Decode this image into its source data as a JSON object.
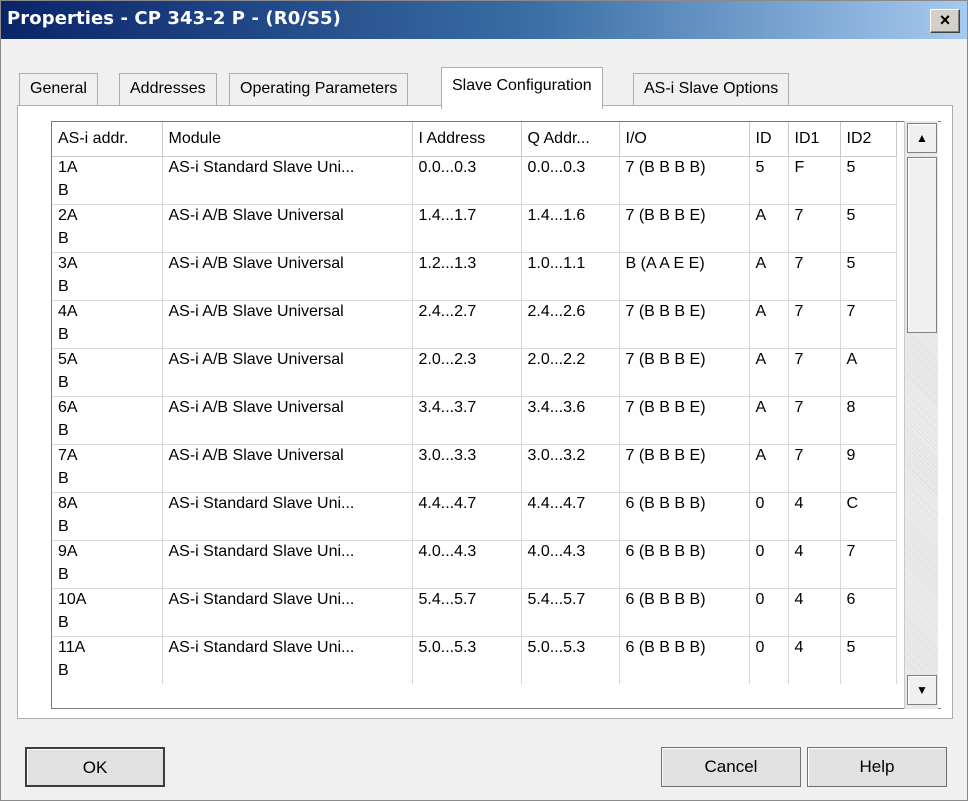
{
  "window": {
    "title": "Properties - CP 343-2 P - (R0/S5)",
    "close_glyph": "×"
  },
  "tabs": [
    {
      "label": "General"
    },
    {
      "label": "Addresses"
    },
    {
      "label": "Operating Parameters"
    },
    {
      "label": "Slave Configuration",
      "active": true
    },
    {
      "label": "AS-i Slave Options"
    }
  ],
  "table": {
    "columns": [
      "AS-i addr.",
      "Module",
      "I Address",
      "Q Addr...",
      "I/O",
      "ID",
      "ID1",
      "ID2"
    ],
    "rows": [
      [
        "1A",
        "AS-i Standard Slave Uni...",
        "0.0...0.3",
        "0.0...0.3",
        "7  (B B B B)",
        "5",
        "F",
        "5"
      ],
      [
        "B",
        "",
        "",
        "",
        "",
        "",
        "",
        ""
      ],
      [
        "2A",
        "AS-i A/B Slave Universal",
        "1.4...1.7",
        "1.4...1.6",
        "7  (B B B E)",
        "A",
        "7",
        "5"
      ],
      [
        "B",
        "",
        "",
        "",
        "",
        "",
        "",
        ""
      ],
      [
        "3A",
        "AS-i A/B Slave Universal",
        "1.2...1.3",
        "1.0...1.1",
        "B  (A A E E)",
        "A",
        "7",
        "5"
      ],
      [
        "B",
        "",
        "",
        "",
        "",
        "",
        "",
        ""
      ],
      [
        "4A",
        "AS-i A/B Slave Universal",
        "2.4...2.7",
        "2.4...2.6",
        "7  (B B B E)",
        "A",
        "7",
        "7"
      ],
      [
        "B",
        "",
        "",
        "",
        "",
        "",
        "",
        ""
      ],
      [
        "5A",
        "AS-i A/B Slave Universal",
        "2.0...2.3",
        "2.0...2.2",
        "7  (B B B E)",
        "A",
        "7",
        "A"
      ],
      [
        "B",
        "",
        "",
        "",
        "",
        "",
        "",
        ""
      ],
      [
        "6A",
        "AS-i A/B Slave Universal",
        "3.4...3.7",
        "3.4...3.6",
        "7  (B B B E)",
        "A",
        "7",
        "8"
      ],
      [
        "B",
        "",
        "",
        "",
        "",
        "",
        "",
        ""
      ],
      [
        "7A",
        "AS-i A/B Slave Universal",
        "3.0...3.3",
        "3.0...3.2",
        "7  (B B B E)",
        "A",
        "7",
        "9"
      ],
      [
        "B",
        "",
        "",
        "",
        "",
        "",
        "",
        ""
      ],
      [
        "8A",
        "AS-i Standard Slave Uni...",
        "4.4...4.7",
        "4.4...4.7",
        "6  (B B B B)",
        "0",
        "4",
        "C"
      ],
      [
        "B",
        "",
        "",
        "",
        "",
        "",
        "",
        ""
      ],
      [
        "9A",
        "AS-i Standard Slave Uni...",
        "4.0...4.3",
        "4.0...4.3",
        "6  (B B B B)",
        "0",
        "4",
        "7"
      ],
      [
        "B",
        "",
        "",
        "",
        "",
        "",
        "",
        ""
      ],
      [
        "10A",
        "AS-i Standard Slave Uni...",
        "5.4...5.7",
        "5.4...5.7",
        "6  (B B B B)",
        "0",
        "4",
        "6"
      ],
      [
        "B",
        "",
        "",
        "",
        "",
        "",
        "",
        ""
      ],
      [
        "11A",
        "AS-i Standard Slave Uni...",
        "5.0...5.3",
        "5.0...5.3",
        "6  (B B B B)",
        "0",
        "4",
        "5"
      ],
      [
        "B",
        "",
        "",
        "",
        "",
        "",
        "",
        ""
      ]
    ]
  },
  "scrollbar": {
    "up_glyph": "▲",
    "down_glyph": "▼"
  },
  "buttons": {
    "ok": "OK",
    "cancel": "Cancel",
    "help": "Help"
  }
}
